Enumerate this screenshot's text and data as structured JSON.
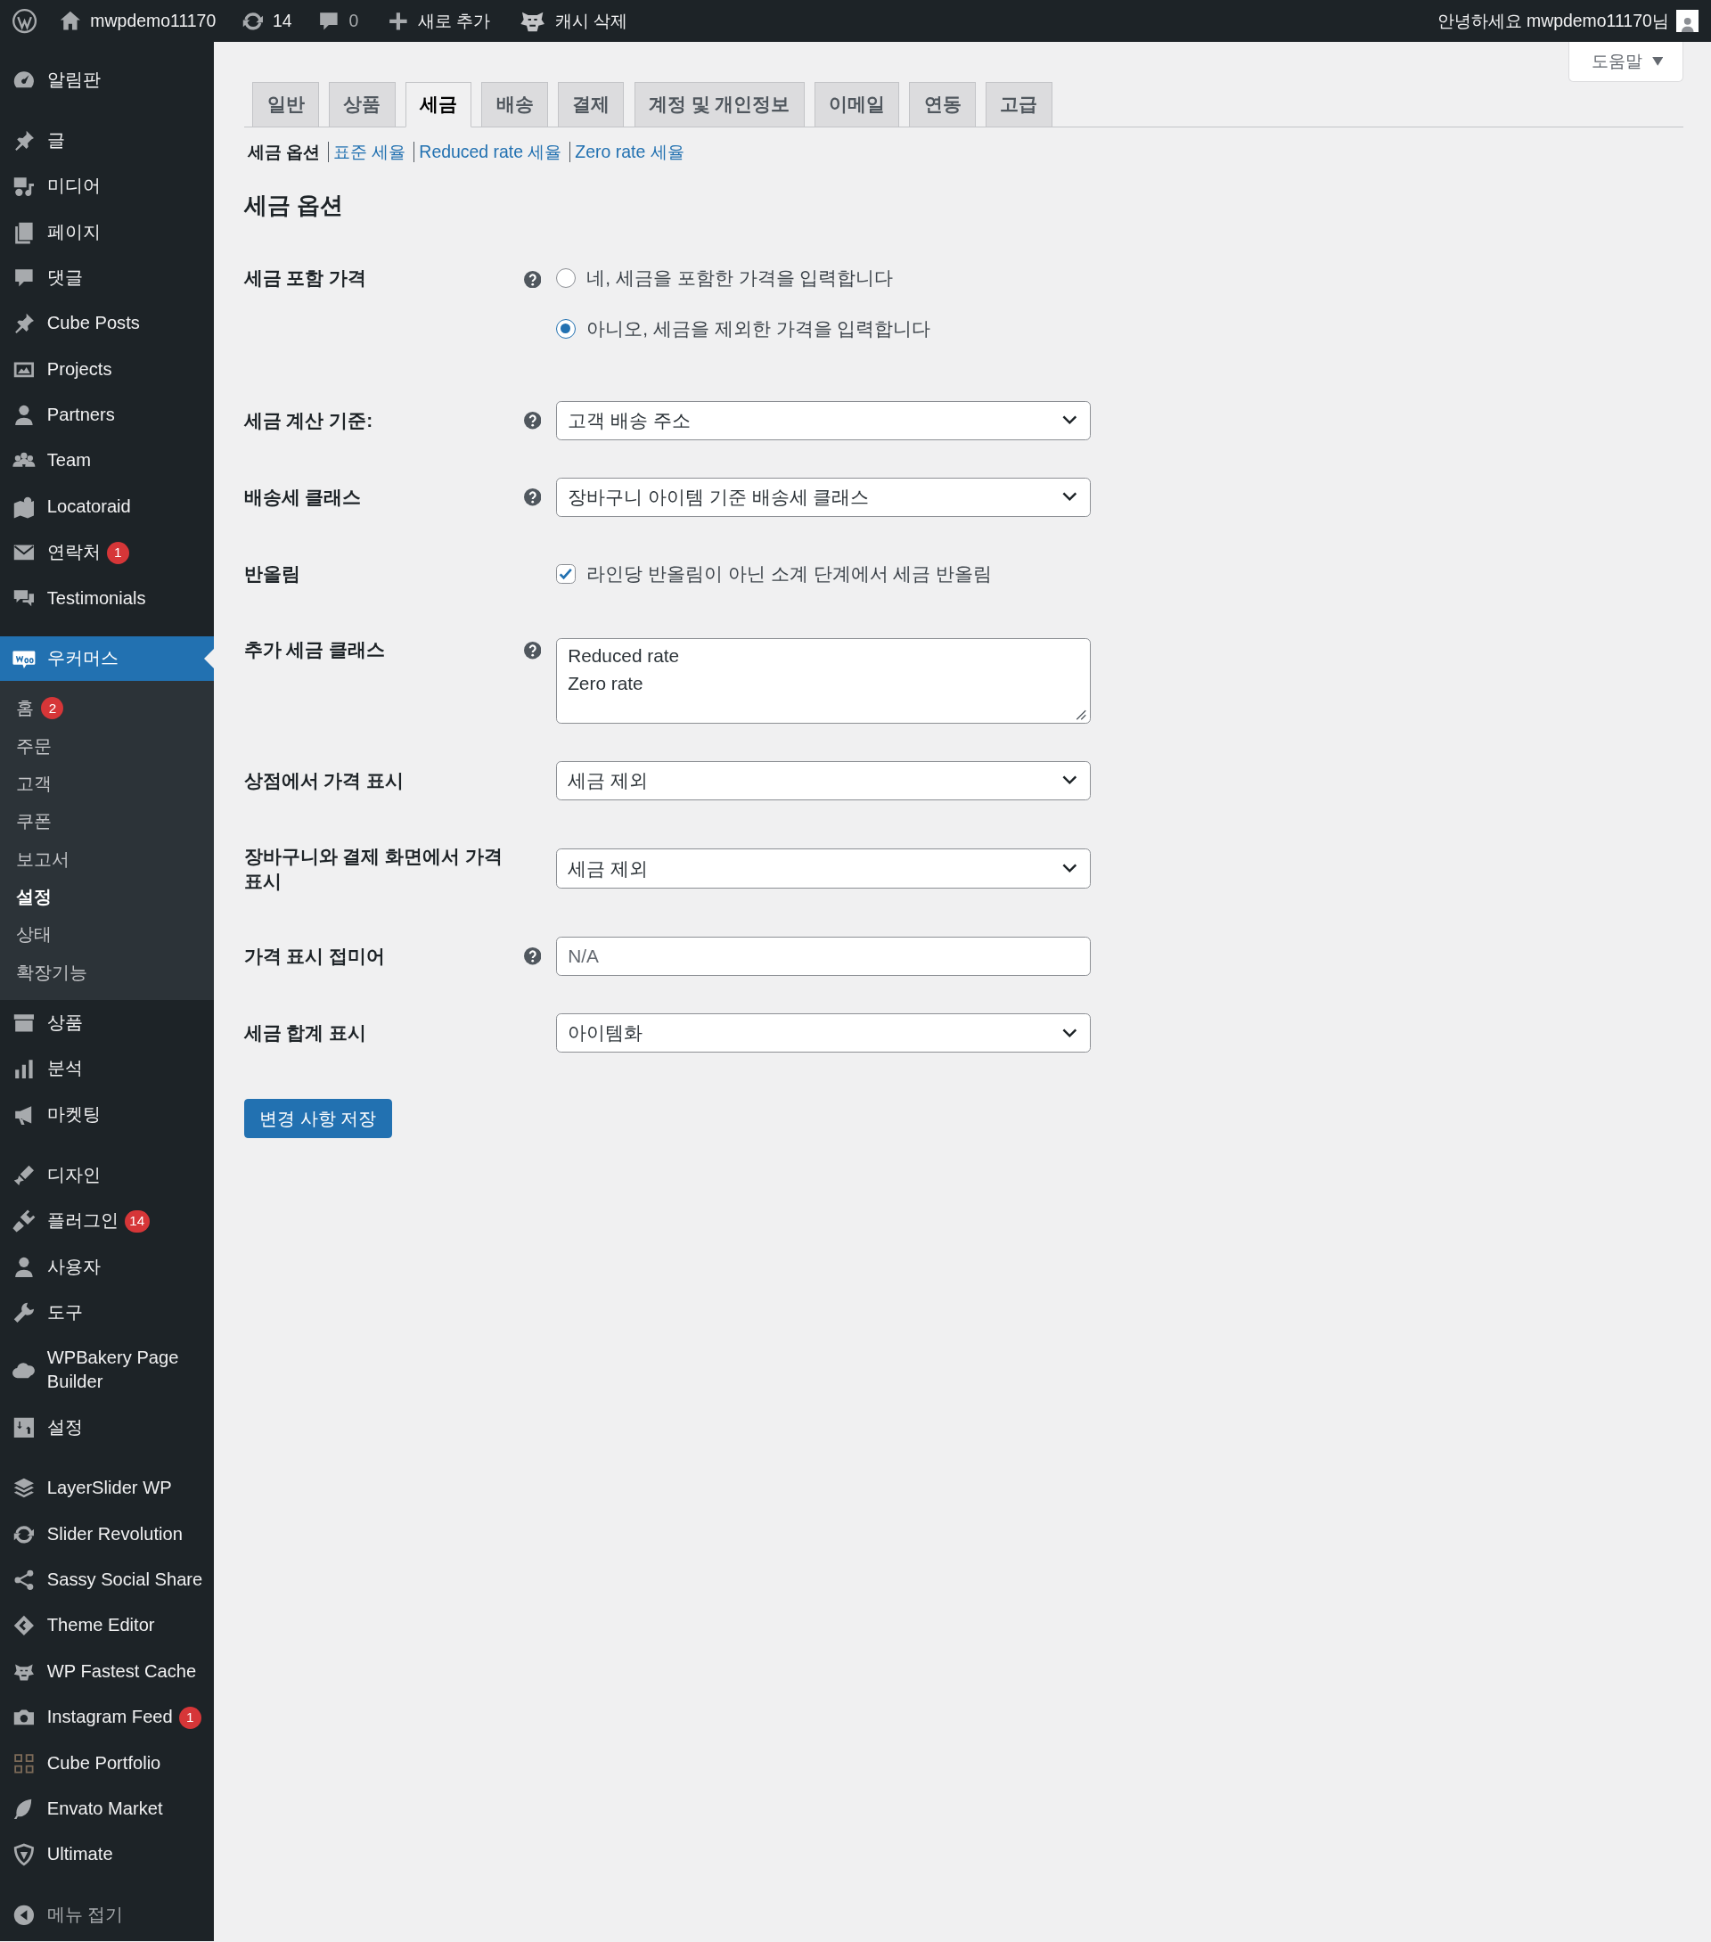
{
  "admin_bar": {
    "site_name": "mwpdemo11170",
    "updates": "14",
    "comments": "0",
    "new_content": "새로 추가",
    "clear_cache": "캐시 삭제",
    "greeting": "안녕하세요 mwpdemo11170님"
  },
  "sidebar": {
    "groups": [
      [
        {
          "label": "알림판",
          "selected": false
        }
      ],
      [
        {
          "label": "글",
          "selected": false
        },
        {
          "label": "미디어",
          "selected": false
        },
        {
          "label": "페이지",
          "selected": false
        },
        {
          "label": "댓글",
          "selected": false
        },
        {
          "label": "Cube Posts",
          "selected": false
        },
        {
          "label": "Projects",
          "selected": false
        },
        {
          "label": "Partners",
          "selected": false
        },
        {
          "label": "Team",
          "selected": false
        },
        {
          "label": "Locatoraid",
          "selected": false
        },
        {
          "label": "연락처",
          "badge": "1",
          "selected": false
        },
        {
          "label": "Testimonials",
          "selected": false
        }
      ],
      [
        {
          "label": "우커머스",
          "selected": true,
          "children": [
            {
              "label": "홈",
              "badge": "2",
              "selected": false
            },
            {
              "label": "주문",
              "selected": false
            },
            {
              "label": "고객",
              "selected": false
            },
            {
              "label": "쿠폰",
              "selected": false
            },
            {
              "label": "보고서",
              "selected": false
            },
            {
              "label": "설정",
              "selected": true
            },
            {
              "label": "상태",
              "selected": false
            },
            {
              "label": "확장기능",
              "selected": false
            }
          ]
        },
        {
          "label": "상품",
          "selected": false
        },
        {
          "label": "분석",
          "selected": false
        },
        {
          "label": "마켓팅",
          "selected": false
        }
      ],
      [
        {
          "label": "디자인",
          "selected": false
        },
        {
          "label": "플러그인",
          "badge": "14",
          "selected": false
        },
        {
          "label": "사용자",
          "selected": false
        },
        {
          "label": "도구",
          "selected": false
        },
        {
          "label": "WPBakery Page Builder",
          "selected": false
        },
        {
          "label": "설정",
          "selected": false
        }
      ],
      [
        {
          "label": "LayerSlider WP",
          "selected": false
        },
        {
          "label": "Slider Revolution",
          "selected": false
        },
        {
          "label": "Sassy Social Share",
          "selected": false
        },
        {
          "label": "Theme Editor",
          "selected": false
        },
        {
          "label": "WP Fastest Cache",
          "selected": false
        },
        {
          "label": "Instagram Feed",
          "badge": "1",
          "selected": false
        },
        {
          "label": "Cube Portfolio",
          "selected": false
        },
        {
          "label": "Envato Market",
          "selected": false
        },
        {
          "label": "Ultimate",
          "selected": false
        }
      ]
    ],
    "collapse": "메뉴 접기"
  },
  "content": {
    "help_tab": "도움말",
    "tabs": [
      {
        "label": "일반",
        "selected": false
      },
      {
        "label": "상품",
        "selected": false
      },
      {
        "label": "세금",
        "selected": true
      },
      {
        "label": "배송",
        "selected": false
      },
      {
        "label": "결제",
        "selected": false
      },
      {
        "label": "계정 및 개인정보",
        "selected": false
      },
      {
        "label": "이메일",
        "selected": false
      },
      {
        "label": "연동",
        "selected": false
      },
      {
        "label": "고급",
        "selected": false
      }
    ],
    "sub_nav": [
      {
        "label": "세금 옵션",
        "selected": true
      },
      {
        "label": "표준 세율",
        "selected": false
      },
      {
        "label": "Reduced rate 세율",
        "selected": false
      },
      {
        "label": "Zero rate 세율",
        "selected": false
      }
    ],
    "heading": "세금 옵션",
    "rows": [
      {
        "kind": "radio",
        "label": "세금 포함 가격",
        "help": true,
        "options": [
          {
            "label": "네, 세금을 포함한 가격을 입력합니다",
            "selected": false
          },
          {
            "label": "아니오, 세금을 제외한 가격을 입력합니다",
            "selected": true
          }
        ]
      },
      {
        "kind": "select",
        "label": "세금 계산 기준:",
        "help": true,
        "value": "고객 배송 주소"
      },
      {
        "kind": "select",
        "label": "배송세 클래스",
        "help": true,
        "value": "장바구니 아이템 기준 배송세 클래스"
      },
      {
        "kind": "checkbox",
        "label": "반올림",
        "help": false,
        "option": "라인당 반올림이 아닌 소계 단계에서 세금 반올림",
        "checked": true
      },
      {
        "kind": "textarea",
        "label": "추가 세금 클래스",
        "help": true,
        "value": "Reduced rate\nZero rate"
      },
      {
        "kind": "select",
        "label": "상점에서 가격 표시",
        "help": false,
        "value": "세금 제외"
      },
      {
        "kind": "select",
        "label": "장바구니와 결제 화면에서 가격 표시",
        "help": false,
        "value": "세금 제외"
      },
      {
        "kind": "input",
        "label": "가격 표시 접미어",
        "help": true,
        "placeholder": "N/A"
      },
      {
        "kind": "select",
        "label": "세금 합계 표시",
        "help": false,
        "value": "아이템화"
      }
    ],
    "save_button": "변경 사항 저장"
  }
}
